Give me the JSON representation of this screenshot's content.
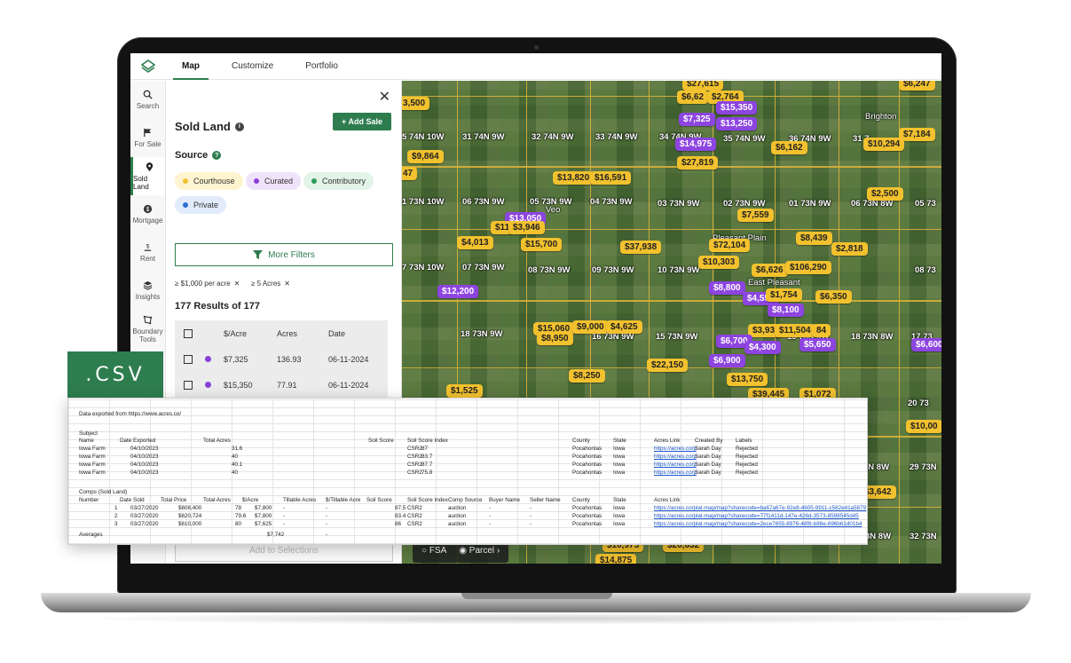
{
  "nav": {
    "tabs": [
      "Map",
      "Customize",
      "Portfolio"
    ],
    "active": "Map"
  },
  "rail": [
    {
      "icon": "search-icon",
      "label": "Search"
    },
    {
      "icon": "flag-icon",
      "label": "For Sale"
    },
    {
      "icon": "map-pin-icon",
      "label": "Sold Land"
    },
    {
      "icon": "dollar-icon",
      "label": "Mortgage"
    },
    {
      "icon": "rent-icon",
      "label": "Rent"
    },
    {
      "icon": "layers-icon",
      "label": "Insights"
    },
    {
      "icon": "boundary-icon",
      "label": "Boundary Tools"
    }
  ],
  "panel": {
    "close": "✕",
    "title": "Sold Land",
    "add_sale": "+ Add Sale",
    "source_label": "Source",
    "sources": [
      {
        "label": "Courthouse",
        "color": "#f2c12e",
        "bg": "#fff4d0"
      },
      {
        "label": "Curated",
        "color": "#8b3fd9",
        "bg": "#efe3fb"
      },
      {
        "label": "Contributory",
        "color": "#2e9a5a",
        "bg": "#e2f3e7"
      },
      {
        "label": "Private",
        "color": "#2f6fd6",
        "bg": "#e1ebfb"
      }
    ],
    "more_filters": "More Filters",
    "filter_tags": [
      "≥ $1,000 per acre",
      "≥ 5 Acres"
    ],
    "results": "177 Results of 177",
    "table": {
      "headers": [
        "$/Acre",
        "Acres",
        "Date"
      ],
      "rows": [
        {
          "price": "$7,325",
          "acres": "136.93",
          "date": "06-11-2024"
        },
        {
          "price": "$15,350",
          "acres": "77.91",
          "date": "06-11-2024"
        }
      ]
    },
    "add_to_selections": "Add to Selections"
  },
  "map": {
    "townships": [
      "5 74N 10W",
      "31 74N 9W",
      "32 74N 9W",
      "33 74N 9W",
      "34 74N 9W",
      "35 74N 9W",
      "36 74N 9W",
      "31 7",
      "1 73N 10W",
      "06 73N 9W",
      "05 73N 9W",
      "04 73N 9W",
      "03 73N 9W",
      "02 73N 9W",
      "01 73N 9W",
      "06 73N 8W",
      "05 73",
      "7 73N 10W",
      "07 73N 9W",
      "08 73N 9W",
      "09 73N 9W",
      "10 73N 9W",
      "08 73",
      "18 73N 9W",
      "16 73N 9W",
      "15 73N 9W",
      "13 73N 9W",
      "18 73N 8W",
      "17 73",
      "20 73",
      "3N 8W",
      "29 73N",
      "3N 8W",
      "32 73N"
    ],
    "places": [
      "Brighton",
      "Pleasant Plain",
      "East Pleasant",
      "Veo"
    ],
    "pins": [
      {
        "t": "$27,615",
        "c": "y"
      },
      {
        "t": "$6,247",
        "c": "y"
      },
      {
        "t": "3,500",
        "c": "y"
      },
      {
        "t": "$6,62",
        "c": "y"
      },
      {
        "t": "$2,764",
        "c": "y"
      },
      {
        "t": "$15,350",
        "c": "p"
      },
      {
        "t": "$7,325",
        "c": "p"
      },
      {
        "t": "$13,250",
        "c": "p"
      },
      {
        "t": "$14,975",
        "c": "p"
      },
      {
        "t": "$6,162",
        "c": "y"
      },
      {
        "t": "$7,184",
        "c": "y"
      },
      {
        "t": "$10,294",
        "c": "y"
      },
      {
        "t": "$9,864",
        "c": "y"
      },
      {
        "t": "$27,819",
        "c": "y"
      },
      {
        "t": "47",
        "c": "y"
      },
      {
        "t": "$13,820",
        "c": "y"
      },
      {
        "t": "$16,591",
        "c": "y"
      },
      {
        "t": "$2,500",
        "c": "y"
      },
      {
        "t": "$13,050",
        "c": "p"
      },
      {
        "t": "$11",
        "c": "y"
      },
      {
        "t": "$3,946",
        "c": "y"
      },
      {
        "t": "$7,559",
        "c": "y"
      },
      {
        "t": "$4,013",
        "c": "y"
      },
      {
        "t": "$15,700",
        "c": "y"
      },
      {
        "t": "$37,938",
        "c": "y"
      },
      {
        "t": "$72,104",
        "c": "y"
      },
      {
        "t": "$8,439",
        "c": "y"
      },
      {
        "t": "$2,818",
        "c": "y"
      },
      {
        "t": "$10,303",
        "c": "y"
      },
      {
        "t": "$6,626",
        "c": "y"
      },
      {
        "t": "$106,290",
        "c": "y"
      },
      {
        "t": "$12,200",
        "c": "p"
      },
      {
        "t": "$8,800",
        "c": "p"
      },
      {
        "t": "$4,550",
        "c": "p"
      },
      {
        "t": "$1,754",
        "c": "y"
      },
      {
        "t": "$6,350",
        "c": "y"
      },
      {
        "t": "$8,100",
        "c": "p"
      },
      {
        "t": "$15,060",
        "c": "y"
      },
      {
        "t": "$9,000",
        "c": "y"
      },
      {
        "t": "$4,625",
        "c": "y"
      },
      {
        "t": "$8,950",
        "c": "y"
      },
      {
        "t": "$3,937",
        "c": "y"
      },
      {
        "t": "$11,504",
        "c": "y"
      },
      {
        "t": "84",
        "c": "y"
      },
      {
        "t": "$6,700",
        "c": "p"
      },
      {
        "t": "$4,300",
        "c": "p"
      },
      {
        "t": "$5,650",
        "c": "p"
      },
      {
        "t": "$6,600",
        "c": "p"
      },
      {
        "t": "$22,150",
        "c": "y"
      },
      {
        "t": "$6,900",
        "c": "p"
      },
      {
        "t": "$8,250",
        "c": "y"
      },
      {
        "t": "$13,750",
        "c": "y"
      },
      {
        "t": "$1,525",
        "c": "y"
      },
      {
        "t": "$39,445",
        "c": "y"
      },
      {
        "t": "$1,072",
        "c": "y"
      },
      {
        "t": "$10,00",
        "c": "y"
      },
      {
        "t": "$3,642",
        "c": "y"
      },
      {
        "t": "$10,975",
        "c": "y"
      },
      {
        "t": "$14,875",
        "c": "y"
      },
      {
        "t": "$20,632",
        "c": "y"
      }
    ],
    "controls": [
      "FSA",
      "Parcel"
    ]
  },
  "badge": ".CSV",
  "sheet": {
    "exported": "Data exported from https://www.acres.co/",
    "subject_label": "Subject",
    "subject_headers": [
      "Name",
      "Date Exported",
      "Total Acres",
      "Soil Score",
      "Soil Score Index",
      "County",
      "State",
      "Acres Link",
      "Created By",
      "Labels"
    ],
    "subjects": [
      [
        "Iowa Farm",
        "04/10/2023",
        "31.6",
        "87",
        "CSR2",
        "Pocahontas",
        "Iowa",
        "https://acres.co/p",
        "Sarah Day",
        "Rejected"
      ],
      [
        "Iowa Farm",
        "04/10/2023",
        "40",
        "83.7",
        "CSR2",
        "Pocahontas",
        "Iowa",
        "https://acres.co/p",
        "Sarah Day",
        "Rejected"
      ],
      [
        "Iowa Farm",
        "04/10/2023",
        "40.1",
        "87.7",
        "CSR2",
        "Pocahontas",
        "Iowa",
        "https://acres.co/p",
        "Sarah Day",
        "Rejected"
      ],
      [
        "Iowa Farm",
        "04/10/2023",
        "40",
        "75.8",
        "CSR2",
        "Pocahontas",
        "Iowa",
        "https://acres.co/p",
        "Sarah Day",
        "Rejected"
      ]
    ],
    "comps_label": "Comps (Sold Land)",
    "comps_headers": [
      "Number",
      "Date Sold",
      "Total Price",
      "Total Acres",
      "$/Acre",
      "Tillable Acres",
      "$/Tillable Acre",
      "Soil Score",
      "Soil Score Index",
      "Comp Source",
      "Buyer Name",
      "Seller Name",
      "County",
      "State",
      "Acres Link"
    ],
    "comps": [
      [
        "1",
        "03/27/2020",
        "$608,400",
        "78",
        "$7,800",
        "-",
        "-",
        "87.5",
        "CSR2",
        "auction",
        "-",
        "-",
        "Pocahontas",
        "Iowa",
        "https://acres.co/plat-map/map?sharecode=ba67a67e-92e8-4605-9911-c582e41a5879"
      ],
      [
        "2",
        "03/27/2020",
        "$620,724",
        "79.6",
        "$7,800",
        "-",
        "-",
        "83.4",
        "CSR2",
        "auction",
        "-",
        "-",
        "Pocahontas",
        "Iowa",
        "https://acres.co/plat-map/map?sharecode=77f1411d-147e-426d-3573-8598545d45"
      ],
      [
        "3",
        "03/27/2020",
        "$610,000",
        "80",
        "$7,625",
        "-",
        "-",
        "86",
        "CSR2",
        "auction",
        "-",
        "-",
        "Pocahontas",
        "Iowa",
        "https://acres.co/plat-map/map?sharecode=2ece7655-8976-48f8-b88e-696b61d01b4"
      ]
    ],
    "averages_label": "Averages",
    "averages_value": "$7,742",
    "averages_dash": "-"
  }
}
